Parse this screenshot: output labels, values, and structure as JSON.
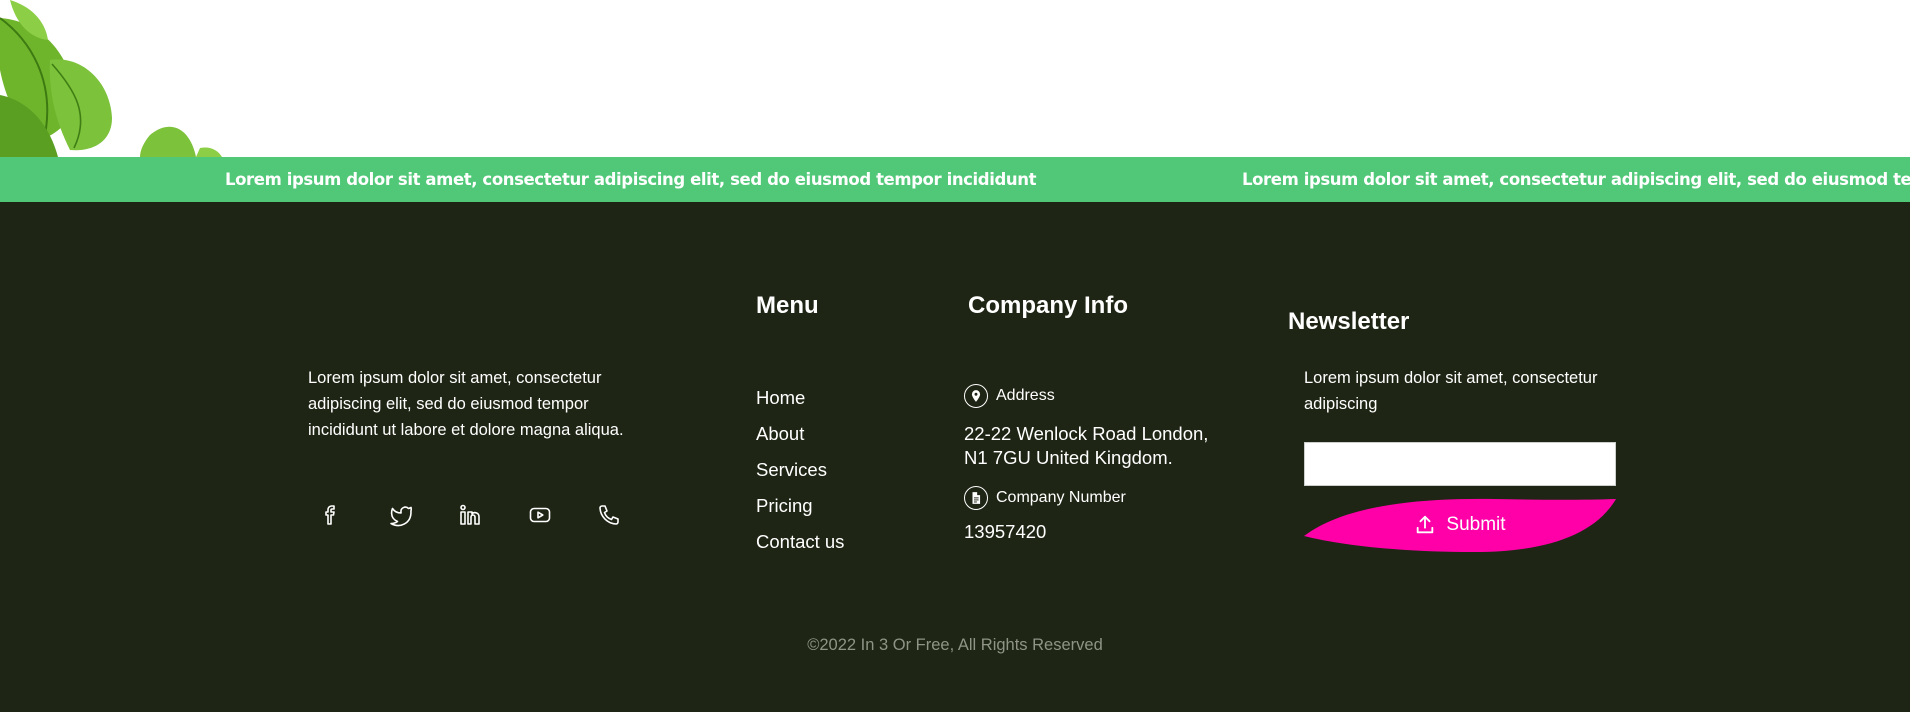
{
  "marquee": {
    "items": [
      "Lorem ipsum dolor sit amet, consectetur adipiscing elit, sed do eiusmod tempor incididunt",
      "Lorem ipsum dolor sit amet, consectetur adipiscing elit, sed do eiusmod tempor incididunt"
    ]
  },
  "about": {
    "text": "Lorem ipsum dolor sit amet, consectetur adipiscing elit, sed do eiusmod tempor incididunt ut labore et dolore magna aliqua."
  },
  "social": {
    "icons": [
      "facebook-icon",
      "twitter-icon",
      "linkedin-icon",
      "youtube-icon",
      "phone-icon"
    ]
  },
  "menu": {
    "title": "Menu",
    "items": [
      "Home",
      "About",
      "Services",
      "Pricing",
      "Contact us"
    ]
  },
  "company": {
    "title": "Company Info",
    "address_label": "Address",
    "address_value": "22-22 Wenlock Road London,\nN1 7GU United Kingdom.",
    "number_label": "Company Number",
    "number_value": "13957420"
  },
  "newsletter": {
    "title": "Newsletter",
    "text": "Lorem ipsum dolor sit amet, consectetur adipiscing",
    "input_value": "",
    "input_placeholder": "",
    "submit_label": "Submit"
  },
  "copyright": "©2022 In 3 Or Free, All Rights Reserved",
  "colors": {
    "marquee_bg": "#50c878",
    "footer_bg": "#1e2514",
    "submit_bg": "#ff00a8"
  }
}
